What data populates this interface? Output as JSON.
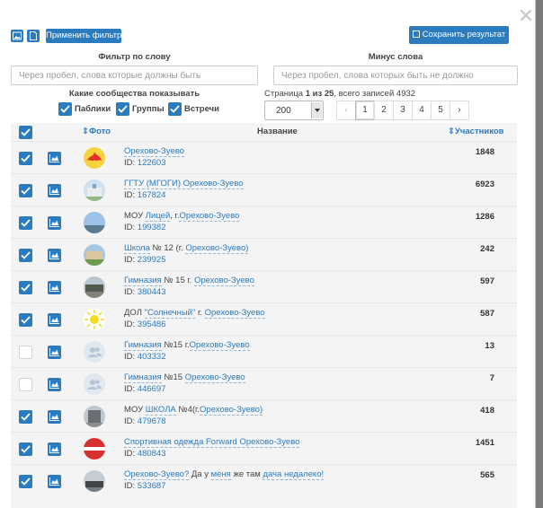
{
  "toolbar": {
    "apply_filter_label": "Применить фильтр",
    "save_result_label": "Сохранить результат"
  },
  "filter": {
    "word_label": "Фильтр по слову",
    "word_placeholder": "Через пробел, слова которые должны быть",
    "minus_label": "Минус слова",
    "minus_placeholder": "Через пробел, слова которых быть не должно",
    "types_label": "Какие сообщества показывать",
    "types": [
      {
        "label": "Паблики",
        "checked": true
      },
      {
        "label": "Группы",
        "checked": true
      },
      {
        "label": "Встречи",
        "checked": true
      }
    ]
  },
  "paging": {
    "prefix": "Страница ",
    "current": "1 из 25",
    "suffix": ", всего записей 4932",
    "per_page": "200",
    "pages": [
      "1",
      "2",
      "3",
      "4",
      "5"
    ],
    "prev_glyph": "‹",
    "next_glyph": "›"
  },
  "table": {
    "col_photo": "Фото",
    "col_name": "Название",
    "col_members": "Участников",
    "id_prefix": "ID: ",
    "rows": [
      {
        "checked": true,
        "title": [
          {
            "t": "Орехово-Зуево",
            "link": true
          }
        ],
        "id": "122603",
        "count": "1848",
        "avatar": "fire"
      },
      {
        "checked": true,
        "title": [
          {
            "t": "ГГТУ (МГОГИ) Орехово-Зуево",
            "link": true
          }
        ],
        "id": "167824",
        "count": "6923",
        "avatar": "building"
      },
      {
        "checked": true,
        "title": [
          {
            "t": "МОУ ",
            "link": false
          },
          {
            "t": "Лицей",
            "link": true
          },
          {
            "t": ", г.",
            "link": false
          },
          {
            "t": "Орехово-Зуево",
            "link": true
          }
        ],
        "id": "199382",
        "count": "1286",
        "avatar": "sky"
      },
      {
        "checked": true,
        "title": [
          {
            "t": "Школа",
            "link": true
          },
          {
            "t": " № 12 (г. ",
            "link": false
          },
          {
            "t": "Орехово-Зуево)",
            "link": true
          }
        ],
        "id": "239925",
        "count": "242",
        "avatar": "school"
      },
      {
        "checked": true,
        "title": [
          {
            "t": "Гимназия",
            "link": true
          },
          {
            "t": " № 15 г. ",
            "link": false
          },
          {
            "t": "Орехово-Зуево",
            "link": true
          }
        ],
        "id": "380443",
        "count": "597",
        "avatar": "street"
      },
      {
        "checked": true,
        "title": [
          {
            "t": "ДОЛ ",
            "link": false
          },
          {
            "t": "\"Солнечный\"",
            "link": true
          },
          {
            "t": " г. ",
            "link": false
          },
          {
            "t": "Орехово-Зуево",
            "link": true
          }
        ],
        "id": "395486",
        "count": "587",
        "avatar": "sun"
      },
      {
        "checked": false,
        "title": [
          {
            "t": "Гимназия",
            "link": true
          },
          {
            "t": " №15 г.",
            "link": false
          },
          {
            "t": "Орехово-Зуево",
            "link": true
          }
        ],
        "id": "403332",
        "count": "13",
        "avatar": "default"
      },
      {
        "checked": false,
        "title": [
          {
            "t": "Гимназия",
            "link": true
          },
          {
            "t": " №15 ",
            "link": false
          },
          {
            "t": "Орехово-Зуево",
            "link": true
          }
        ],
        "id": "446697",
        "count": "7",
        "avatar": "default"
      },
      {
        "checked": true,
        "title": [
          {
            "t": "МОУ ",
            "link": false
          },
          {
            "t": "ШКОЛА",
            "link": true
          },
          {
            "t": " №4(г.",
            "link": false
          },
          {
            "t": "Орехово-Зуево)",
            "link": true
          }
        ],
        "id": "479678",
        "count": "418",
        "avatar": "tower"
      },
      {
        "checked": true,
        "title": [
          {
            "t": "Спортивная одежда Forward Орехово-Зуево",
            "link": true
          }
        ],
        "id": "480843",
        "count": "1451",
        "avatar": "flag"
      },
      {
        "checked": true,
        "title": [
          {
            "t": "Орехово-Зуево?",
            "link": true
          },
          {
            "t": " Да у ",
            "link": false
          },
          {
            "t": "меня",
            "link": true
          },
          {
            "t": " же там ",
            "link": false
          },
          {
            "t": "дача недалеко!",
            "link": true
          }
        ],
        "id": "533687",
        "count": "565",
        "avatar": "car"
      }
    ]
  },
  "colors": {
    "accent": "#2b7bbf",
    "table_bg": "#f4f4f4"
  }
}
